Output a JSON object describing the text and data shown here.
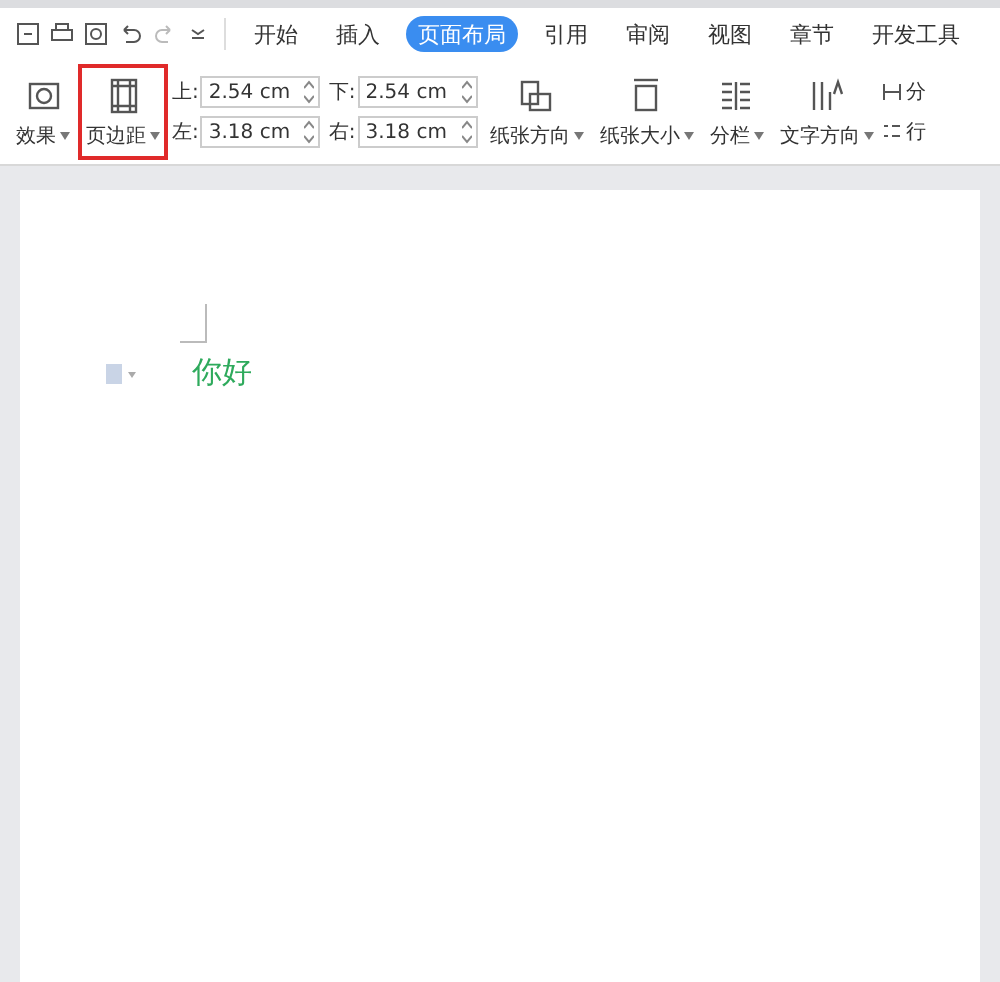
{
  "tabs": [
    {
      "label": "开始",
      "selected": false
    },
    {
      "label": "插入",
      "selected": false
    },
    {
      "label": "页面布局",
      "selected": true
    },
    {
      "label": "引用",
      "selected": false
    },
    {
      "label": "审阅",
      "selected": false
    },
    {
      "label": "视图",
      "selected": false
    },
    {
      "label": "章节",
      "selected": false
    },
    {
      "label": "开发工具",
      "selected": false
    }
  ],
  "ribbon": {
    "effects": {
      "label": "效果"
    },
    "margins": {
      "label": "页边距",
      "highlighted": true
    },
    "margin_fields": [
      {
        "label": "上:",
        "value": "2.54 cm"
      },
      {
        "label": "下:",
        "value": "2.54 cm"
      },
      {
        "label": "左:",
        "value": "3.18 cm"
      },
      {
        "label": "右:",
        "value": "3.18 cm"
      }
    ],
    "tools": [
      {
        "kind": "orientation",
        "label": "纸张方向"
      },
      {
        "kind": "size",
        "label": "纸张大小"
      },
      {
        "kind": "columns",
        "label": "分栏"
      },
      {
        "kind": "direction",
        "label": "文字方向"
      }
    ],
    "cut_tools": [
      {
        "kind": "breaks",
        "label": "分"
      },
      {
        "kind": "numbers",
        "label": "行"
      }
    ]
  },
  "document": {
    "text": "你好"
  }
}
